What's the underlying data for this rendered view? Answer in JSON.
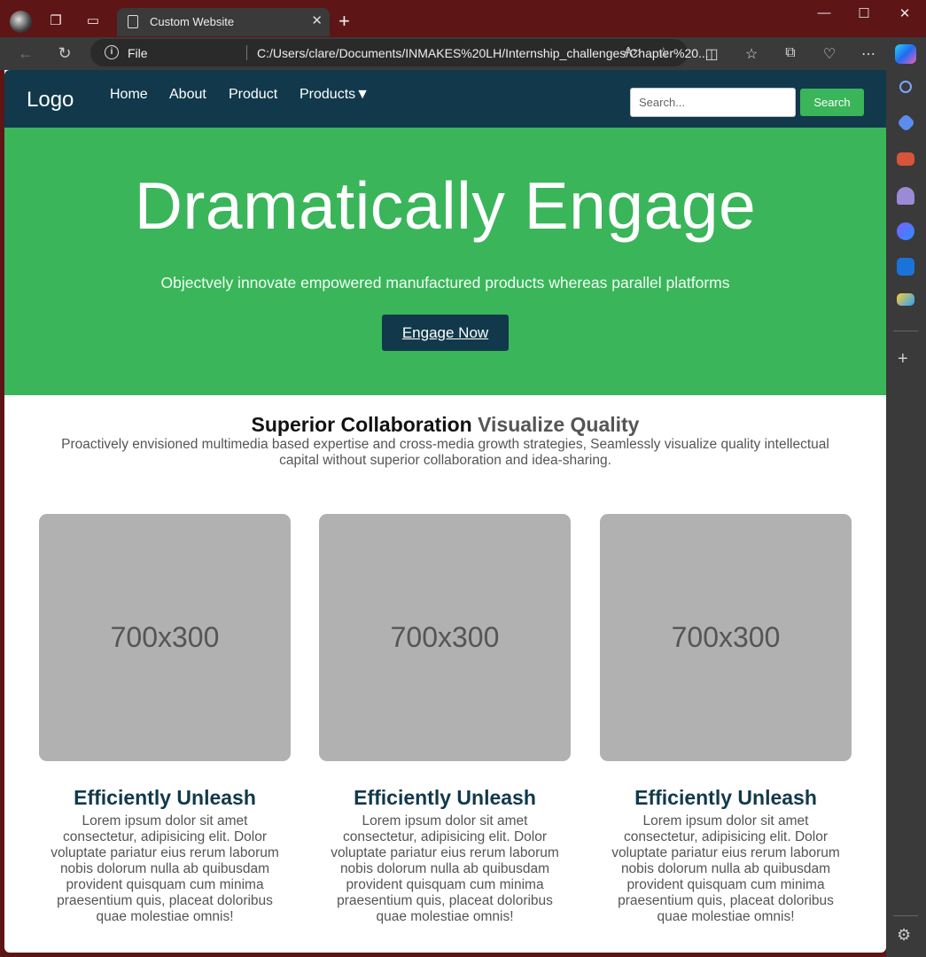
{
  "browser": {
    "tab_title": "Custom Website",
    "address_prefix": "File",
    "url": "C:/Users/clare/Documents/INMAKES%20LH/Internship_challenges/Chapter%20..."
  },
  "navbar": {
    "logo": "Logo",
    "links": [
      "Home",
      "About",
      "Product",
      "Products▼"
    ],
    "search_placeholder": "Search...",
    "search_button": "Search"
  },
  "hero": {
    "title": "Dramatically Engage",
    "subtitle": "Objectvely innovate empowered manufactured products whereas parallel platforms",
    "cta": "Engage Now"
  },
  "section": {
    "title_main": "Superior Collaboration",
    "title_accent": "Visualize Quality",
    "description": "Proactively envisioned multimedia based expertise and cross-media growth strategies, Seamlessly visualize quality intellectual capital without superior collaboration and idea-sharing."
  },
  "cards": [
    {
      "image_label": "700x300",
      "title": "Efficiently Unleash",
      "text": "Lorem ipsum dolor sit amet consectetur, adipisicing elit. Dolor voluptate pariatur eius rerum laborum nobis dolorum nulla ab quibusdam provident quisquam cum minima praesentium quis, placeat doloribus quae molestiae omnis!"
    },
    {
      "image_label": "700x300",
      "title": "Efficiently Unleash",
      "text": "Lorem ipsum dolor sit amet consectetur, adipisicing elit. Dolor voluptate pariatur eius rerum laborum nobis dolorum nulla ab quibusdam provident quisquam cum minima praesentium quis, placeat doloribus quae molestiae omnis!"
    },
    {
      "image_label": "700x300",
      "title": "Efficiently Unleash",
      "text": "Lorem ipsum dolor sit amet consectetur, adipisicing elit. Dolor voluptate pariatur eius rerum laborum nobis dolorum nulla ab quibusdam provident quisquam cum minima praesentium quis, placeat doloribus quae molestiae omnis!"
    }
  ],
  "colors": {
    "navbar": "#11394b",
    "hero": "#3ab55a",
    "placeholder_image": "#b1b1b1",
    "browser_frame": "#5e1515"
  }
}
